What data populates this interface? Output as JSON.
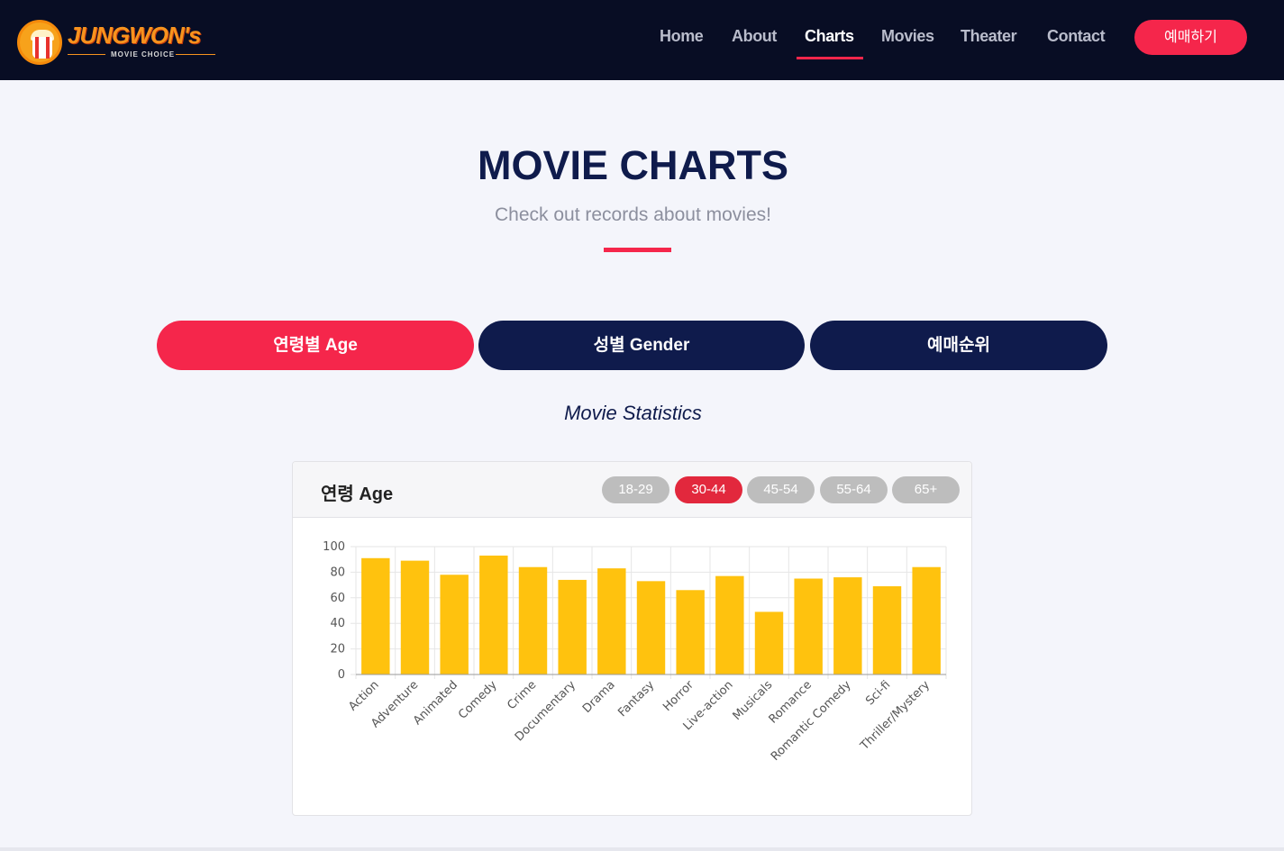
{
  "header": {
    "logo_text": "JUNGWON's",
    "logo_sub": "MOVIE CHOICE",
    "nav": [
      {
        "label": "Home"
      },
      {
        "label": "About"
      },
      {
        "label": "Charts"
      },
      {
        "label": "Movies"
      },
      {
        "label": "Theater"
      },
      {
        "label": "Contact"
      }
    ],
    "active_nav": "Charts",
    "book_label": "예매하기"
  },
  "hero": {
    "title": "MOVIE CHARTS",
    "subtitle": "Check out records about movies!"
  },
  "tabs": [
    {
      "label": "연령별 Age",
      "active": true
    },
    {
      "label": "성별 Gender",
      "active": false
    },
    {
      "label": "예매순위",
      "active": false
    }
  ],
  "stats_title": "Movie Statistics",
  "card": {
    "title": "연령 Age",
    "age_groups": [
      {
        "label": "18-29",
        "active": false
      },
      {
        "label": "30-44",
        "active": true
      },
      {
        "label": "45-54",
        "active": false
      },
      {
        "label": "55-64",
        "active": false
      },
      {
        "label": "65+",
        "active": false
      }
    ]
  },
  "colors": {
    "accent": "#f5264b",
    "navy": "#0f1b4c",
    "bar": "#ffc20e"
  },
  "chart_data": {
    "type": "bar",
    "title": "",
    "xlabel": "",
    "ylabel": "",
    "ylim": [
      0,
      100
    ],
    "yticks": [
      "0",
      "20",
      "40",
      "60",
      "80",
      "100"
    ],
    "grid": true,
    "categories": [
      "Action",
      "Adventure",
      "Animated",
      "Comedy",
      "Crime",
      "Documentary",
      "Drama",
      "Fantasy",
      "Horror",
      "Live-action",
      "Musicals",
      "Romance",
      "Romantic Comedy",
      "Sci-fi",
      "Thriller/Mystery"
    ],
    "values": [
      91,
      89,
      78,
      93,
      84,
      74,
      83,
      73,
      66,
      77,
      49,
      75,
      76,
      69,
      84
    ]
  }
}
